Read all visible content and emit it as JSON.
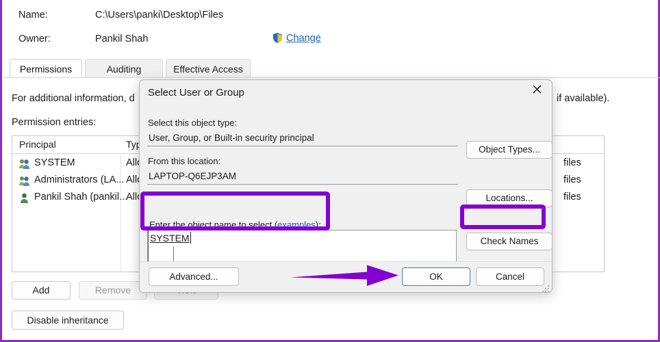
{
  "theme": {
    "accent_purple": "#8400d1",
    "frame_purple": "#8e2bbd",
    "link_blue": "#1f5fae",
    "focus_blue": "#3b7dbd"
  },
  "background_window": {
    "fields": [
      {
        "label": "Name:",
        "value": "C:\\Users\\panki\\Desktop\\Files"
      },
      {
        "label": "Owner:",
        "value": "Pankil Shah"
      }
    ],
    "change_link": "Change",
    "shield_icon": "uac-shield-icon",
    "tabs": [
      {
        "label": "Permissions",
        "active": true
      },
      {
        "label": "Auditing",
        "active": false
      },
      {
        "label": "Effective Access",
        "active": false
      }
    ],
    "info_text": "For additional information, d",
    "info_text_right": "if available).",
    "entries_label": "Permission entries:",
    "table": {
      "columns": [
        "Principal",
        "Typ"
      ],
      "rows": [
        {
          "icon": "group-users-icon",
          "principal": "SYSTEM",
          "type": "Allo",
          "applies": "files"
        },
        {
          "icon": "group-users-icon",
          "principal": "Administrators (LA...",
          "type": "Allo",
          "applies": "files"
        },
        {
          "icon": "single-user-icon",
          "principal": "Pankil Shah (pankil...",
          "type": "Allo",
          "applies": "files"
        }
      ]
    },
    "buttons": {
      "add": "Add",
      "remove": "Remove",
      "view": "View",
      "disable_inheritance": "Disable inheritance"
    }
  },
  "dialog": {
    "title": "Select User or Group",
    "close_icon": "close-icon",
    "object_type_label": "Select this object type:",
    "object_type_value": "User, Group, or Built-in security principal",
    "object_types_button": "Object Types...",
    "location_label": "From this location:",
    "location_value": "LAPTOP-Q6EJP3AM",
    "locations_button": "Locations...",
    "enter_name_label_prefix": "E",
    "enter_name_label_mid": "nter the object name to select (",
    "enter_name_examples": "examples",
    "enter_name_label_suffix": "):",
    "object_name_value": "SYSTEM",
    "check_names_button": "Check Names",
    "advanced_button": "Advanced...",
    "ok_button": "OK",
    "cancel_button": "Cancel",
    "resize_grip": "resize-grip-icon"
  },
  "annotations": {
    "highlight_object_name": "purple-highlight-box",
    "highlight_check_names": "purple-highlight-box",
    "arrow_to_ok": "purple-arrow-pointing-right"
  }
}
